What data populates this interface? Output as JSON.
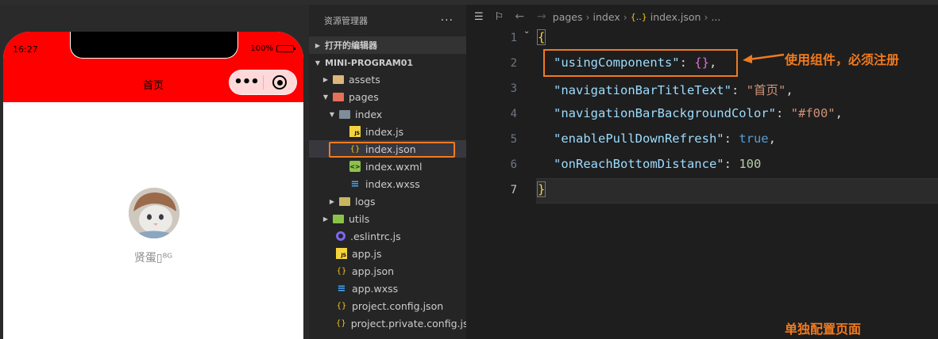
{
  "simulator": {
    "status_time": "16:27",
    "battery_text": "100%",
    "nav_title": "首页",
    "capsule_more": "•••",
    "nickname": "贤蛋▯⁸ᴳ"
  },
  "explorer": {
    "header_title": "资源管理器",
    "header_more": "···",
    "section_open_editors": "打开的编辑器",
    "section_project": "MINI-PROGRAM01",
    "tree": [
      {
        "label": "assets"
      },
      {
        "label": "pages"
      },
      {
        "label": "index"
      },
      {
        "label": "index.js"
      },
      {
        "label": "index.json"
      },
      {
        "label": "index.wxml"
      },
      {
        "label": "index.wxss"
      },
      {
        "label": "logs"
      },
      {
        "label": "utils"
      },
      {
        "label": ".eslintrc.js"
      },
      {
        "label": "app.js"
      },
      {
        "label": "app.json"
      },
      {
        "label": "app.wxss"
      },
      {
        "label": "project.config.json"
      },
      {
        "label": "project.private.config.js..."
      }
    ]
  },
  "editor": {
    "breadcrumb": {
      "part1": "pages",
      "part2": "index",
      "part3": "index.json",
      "part4": "..."
    },
    "lines": [
      {
        "no": "1",
        "content": "{"
      },
      {
        "no": "2",
        "key": "\"usingComponents\"",
        "value": "{}"
      },
      {
        "no": "3",
        "key": "\"navigationBarTitleText\"",
        "value": "\"首页\""
      },
      {
        "no": "4",
        "key": "\"navigationBarBackgroundColor\"",
        "value": "\"#f00\""
      },
      {
        "no": "5",
        "key": "\"enablePullDownRefresh\"",
        "value": "true"
      },
      {
        "no": "6",
        "key": "\"onReachBottomDistance\"",
        "value": "100"
      },
      {
        "no": "7",
        "content": "}"
      }
    ]
  },
  "annotations": {
    "components_note": "使用组件，必须注册",
    "page_note": "单独配置页面"
  },
  "colors": {
    "accent": "#f07a1f",
    "nav_background": "#ff0000"
  }
}
